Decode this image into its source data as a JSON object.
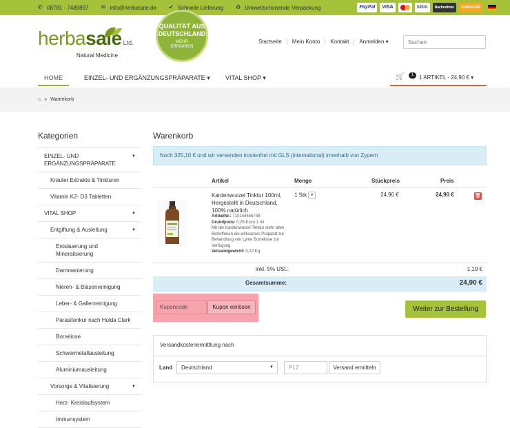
{
  "topbar": {
    "phone": "08781 - 7489897",
    "email": "info@herbasale.de",
    "delivery": "Schnelle Lieferung",
    "packaging": "Umweltschonende Verpackung",
    "payments": [
      "PayPal",
      "VISA",
      "SEPA",
      "Nachnahme",
      "VORKASSE"
    ]
  },
  "logo": {
    "brand_light": "herba",
    "brand_bold": "sale",
    "ltd": "Ltd.",
    "tagline": "Natural Medicine"
  },
  "seal": {
    "line1": "QUALITÄT AUS",
    "line2": "DEUTSCHLAND",
    "line3": "MEHR",
    "line4": "ERFAHREN"
  },
  "topnav": {
    "start": "Startseite",
    "account": "Mein Konto",
    "contact": "Kontakt",
    "login": "Anmelden ▾"
  },
  "search": {
    "placeholder": "Suchen"
  },
  "mainnav": {
    "home": "HOME",
    "single": "EINZEL- UND ERGÄNZUNGSPRÄPARATE ▾",
    "vital": "VITAL SHOP ▾"
  },
  "cart": {
    "count": "1",
    "summary": "1 ARTIKEL - 24,90 € ▾"
  },
  "breadcrumb": {
    "sep": "»",
    "current": "Warenkorb"
  },
  "sidebar": {
    "title": "Kategorien",
    "items": [
      {
        "label": "EINZEL- UND ERGÄNZUNGSPRÄPARATE",
        "level": 1,
        "caret": "▼"
      },
      {
        "label": "Kräuter Extrakte & Tinkturen",
        "level": 2,
        "caret": ""
      },
      {
        "label": "Vitamin K2- D3 Tabletten",
        "level": 2,
        "caret": ""
      },
      {
        "label": "VITAL SHOP",
        "level": 1,
        "caret": "▼"
      },
      {
        "label": "Entgiftung & Ausleitung",
        "level": 2,
        "caret": "▼"
      },
      {
        "label": "Entsäuerung und Mineralisierung",
        "level": 3,
        "caret": ""
      },
      {
        "label": "Darmsanierung",
        "level": 3,
        "caret": ""
      },
      {
        "label": "Nieren- & Blasenreinigung",
        "level": 3,
        "caret": ""
      },
      {
        "label": "Leber- & Gallenreinigung",
        "level": 3,
        "caret": ""
      },
      {
        "label": "Parasitenkur nach Hulda Clark",
        "level": 3,
        "caret": ""
      },
      {
        "label": "Borreliose",
        "level": 3,
        "caret": ""
      },
      {
        "label": "Schwermetallausleitung",
        "level": 3,
        "caret": ""
      },
      {
        "label": "Aluminiumausleitung",
        "level": 3,
        "caret": ""
      },
      {
        "label": "Vorsorge & Vitalisierung",
        "level": 2,
        "caret": "▼"
      },
      {
        "label": "Herz- Kreislaufsystem",
        "level": 3,
        "caret": ""
      },
      {
        "label": "Immunsystem",
        "level": 3,
        "caret": ""
      }
    ]
  },
  "main": {
    "title": "Warenkorb",
    "notice": "Noch 325,10 € und wir versenden kostenfrei mit GLS (international) innerhalb von Zypern",
    "headers": {
      "article": "Artikel",
      "qty": "Menge",
      "unit": "Stückpreis",
      "price": "Preis"
    },
    "product": {
      "name": "Kardenwurzel Tinktur 100ml, Hergestellt in Deutschland, 100% natürlich",
      "artnr_label": "ArtikelNr.:",
      "artnr": "710144545748",
      "base_label": "Grundpreis:",
      "base": "0,25 € pro 1 ml",
      "desc": "Mit der Kardenwurzel Tinktur steht allen Betroffenen ein wirksames Präparat zur Behandlung von Lyme Borreliose zur Verfügung",
      "weight_label": "Versandgewicht:",
      "weight": "0,22 Kg",
      "qty": "1 Stk",
      "unit_price": "24,90 €",
      "price": "24,90 €"
    },
    "tax_label": "inkl. 5% USt.:",
    "tax_value": "1,19 €",
    "total_label": "Gesamtsumme:",
    "total_value": "24,90 €",
    "coupon": {
      "placeholder": "Kuponcode",
      "button": "Kupon einlösen"
    },
    "order_button": "Weiter zur Bestellung",
    "shipping": {
      "heading": "Versandkostenermittlung nach",
      "land_label": "Land",
      "country": "Deutschland",
      "plz_placeholder": "PLZ",
      "button": "Versand ermitteln"
    }
  },
  "colors": {
    "accent_green": "#a6c13a",
    "info_bg": "#d9edf7",
    "coupon_highlight": "#f7a3ad",
    "trash": "#d9534f"
  }
}
